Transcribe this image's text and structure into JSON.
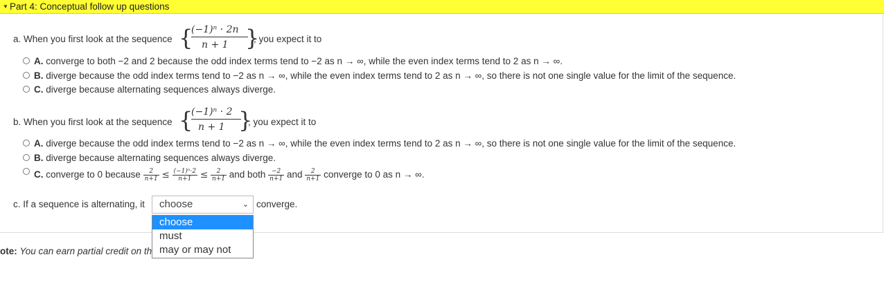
{
  "header": {
    "title": "Part 4: Conceptual follow up questions"
  },
  "part_a": {
    "prompt": "a. When you first look at the sequence",
    "seq_num": "(−1)ⁿ · 2n",
    "seq_den": "n + 1",
    "suffix": ", you expect it to",
    "options": [
      {
        "letter": "A.",
        "text": "converge to both −2 and 2 because the odd index terms tend to −2 as n → ∞, while the even index terms tend to 2 as n → ∞."
      },
      {
        "letter": "B.",
        "text": "diverge because the odd index terms tend to −2 as n → ∞, while the even index terms tend to 2 as n → ∞, so there is not one single value for the limit of the sequence."
      },
      {
        "letter": "C.",
        "text": "diverge because alternating sequences always diverge."
      }
    ]
  },
  "part_b": {
    "prompt": "b. When you first look at the sequence",
    "seq_num": "(−1)ⁿ · 2",
    "seq_den": "n + 1",
    "suffix": ", you expect it to",
    "options": [
      {
        "letter": "A.",
        "text": "diverge because the odd index terms tend to −2 as n → ∞, while the even index terms tend to 2 as n → ∞, so there is not one single value for the limit of the sequence."
      },
      {
        "letter": "B.",
        "text": "diverge because alternating sequences always diverge."
      }
    ],
    "option_c": {
      "letter": "C.",
      "t1": "converge to 0 because",
      "f1_num": "2",
      "f1_den": "n+1",
      "le": "≤",
      "f2_num": "(−1)ⁿ·2",
      "f2_den": "n+1",
      "f3_num": "2",
      "f3_den": "n+1",
      "t2": "and both",
      "f4_num": "−2",
      "f4_den": "n+1",
      "t3": "and",
      "f5_num": "2",
      "f5_den": "n+1",
      "t4": "converge to 0 as n → ∞."
    }
  },
  "part_c": {
    "prompt": "c. If a sequence is alternating, it",
    "selected": "choose",
    "suffix": "converge.",
    "options": [
      "choose",
      "must",
      "may or may not"
    ]
  },
  "note": {
    "label": "ote:",
    "text": "You can earn partial credit on th"
  }
}
